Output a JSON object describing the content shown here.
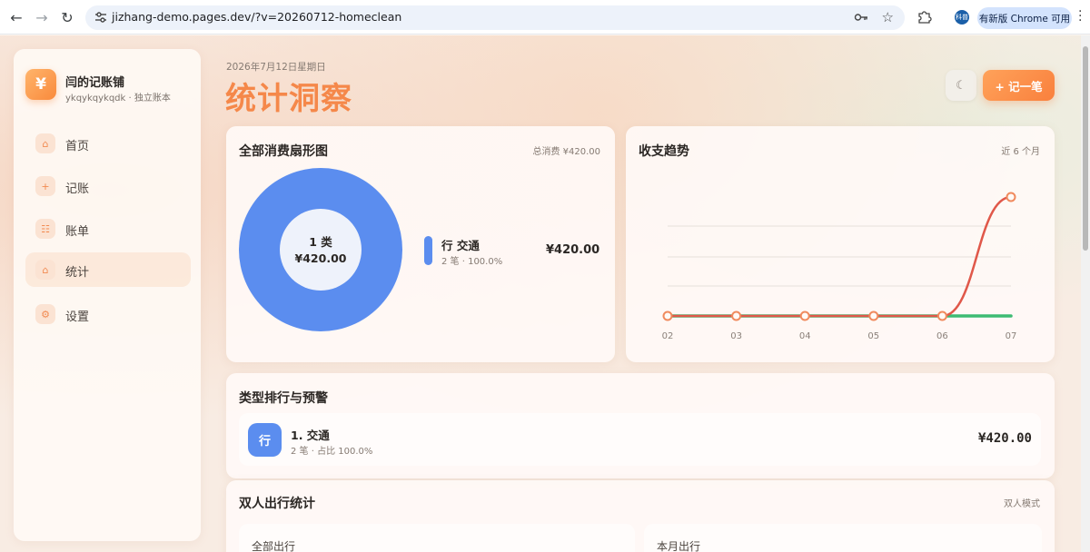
{
  "browser": {
    "url": "jizhang-demo.pages.dev/?v=20260712-homeclean",
    "profile_label": "科普",
    "update_label": "有新版 Chrome 可用"
  },
  "sidebar": {
    "brand_name": "闫的记账铺",
    "brand_sub": "ykqykqykqdk · 独立账本",
    "logo_glyph": "¥",
    "items": [
      {
        "label": "首页",
        "icon": "home-icon",
        "glyph": "⌂"
      },
      {
        "label": "记账",
        "icon": "plus-icon",
        "glyph": "+"
      },
      {
        "label": "账单",
        "icon": "list-icon",
        "glyph": "☷"
      },
      {
        "label": "统计",
        "icon": "stats-icon",
        "glyph": "⌂",
        "active": true
      },
      {
        "label": "设置",
        "icon": "gear-icon",
        "glyph": "⚙"
      }
    ]
  },
  "header": {
    "date": "2026年7月12日星期日",
    "title": "统计洞察",
    "theme_glyph": "☾",
    "add_label": "+ 记一笔"
  },
  "pie_card": {
    "title": "全部消费扇形图",
    "total": "总消费 ¥420.00",
    "center_count": "1 类",
    "center_amount": "¥420.00",
    "legend": [
      {
        "name": "行 交通",
        "sub": "2 笔 · 100.0%",
        "amount": "¥420.00",
        "color": "#5b8def"
      }
    ]
  },
  "trend_card": {
    "title": "收支趋势",
    "range": "近 6 个月"
  },
  "ranking_card": {
    "title": "类型排行与预警",
    "items": [
      {
        "icon": "行",
        "name": "1. 交通",
        "sub": "2 笔 · 占比 100.0%",
        "amount": "¥420.00",
        "color": "#5b8def"
      }
    ]
  },
  "travel_card": {
    "title": "双人出行统计",
    "mode": "双人模式",
    "sections": [
      "全部出行",
      "本月出行"
    ]
  },
  "chart_data": [
    {
      "type": "pie",
      "categories": [
        "行 交通"
      ],
      "values": [
        420.0
      ],
      "colors": [
        "#5b8def"
      ]
    },
    {
      "type": "line",
      "x": [
        "02",
        "03",
        "04",
        "05",
        "06",
        "07"
      ],
      "series": [
        {
          "values": [
            0,
            0,
            0,
            0,
            0,
            420
          ],
          "color": "#e0584a"
        },
        {
          "values": [
            0,
            0,
            0,
            0,
            0,
            0
          ],
          "color": "#3dbb73"
        }
      ],
      "ylim": [
        0,
        420
      ],
      "grid": true
    }
  ]
}
